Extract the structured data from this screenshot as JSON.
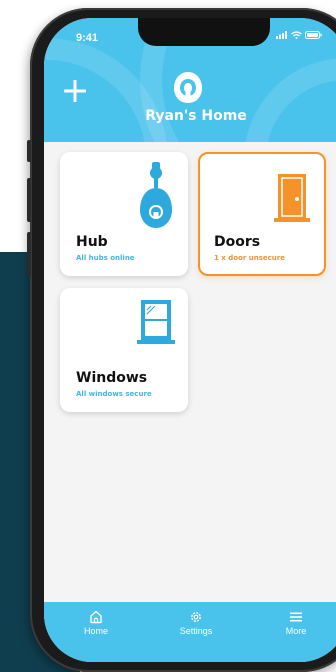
{
  "status_bar": {
    "time": "9:41"
  },
  "header": {
    "title": "Ryan's Home"
  },
  "cards": [
    {
      "title": "Hub",
      "status": "All hubs online"
    },
    {
      "title": "Doors",
      "status": "1 x door unsecure"
    },
    {
      "title": "Windows",
      "status": "All windows secure"
    }
  ],
  "tabs": [
    {
      "label": "Home",
      "icon": "home-icon"
    },
    {
      "label": "Settings",
      "icon": "gear-icon"
    },
    {
      "label": "More",
      "icon": "menu-icon"
    }
  ],
  "colors": {
    "brand": "#49c2ec",
    "warning": "#f5922a",
    "backdrop": "#0f3f4f"
  }
}
